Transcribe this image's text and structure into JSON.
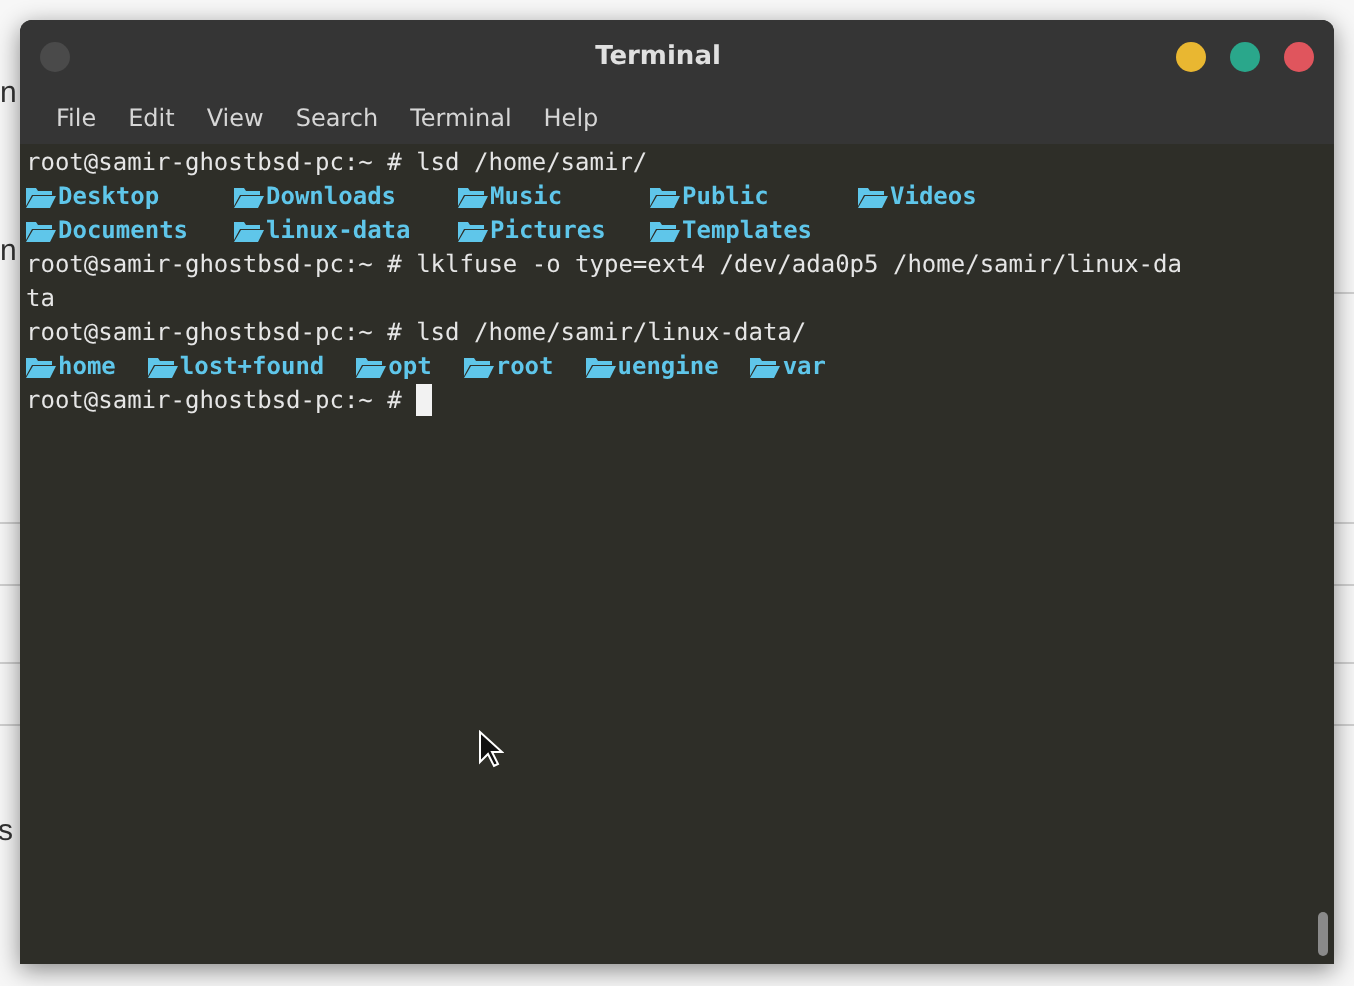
{
  "background_page": {
    "texts": [
      "n",
      "n",
      "s"
    ]
  },
  "window": {
    "title": "Terminal"
  },
  "menu": [
    "File",
    "Edit",
    "View",
    "Search",
    "Terminal",
    "Help"
  ],
  "terminal_lines": [
    {
      "kind": "text",
      "text": "root@samir-ghostbsd-pc:~ # lsd /home/samir/"
    },
    {
      "kind": "columns",
      "entries": [
        "Desktop",
        "Downloads",
        "Music",
        "Public",
        "Videos"
      ]
    },
    {
      "kind": "columns",
      "entries": [
        "Documents",
        "linux-data",
        "Pictures",
        "Templates"
      ]
    },
    {
      "kind": "text",
      "text": "root@samir-ghostbsd-pc:~ # lklfuse -o type=ext4 /dev/ada0p5 /home/samir/linux-da"
    },
    {
      "kind": "text",
      "text": "ta"
    },
    {
      "kind": "text",
      "text": "root@samir-ghostbsd-pc:~ # lsd /home/samir/linux-data/"
    },
    {
      "kind": "flow",
      "entries": [
        "home",
        "lost+found",
        "opt",
        "root",
        "uengine",
        "var"
      ]
    },
    {
      "kind": "cursor",
      "text": "root@samir-ghostbsd-pc:~ # "
    }
  ]
}
